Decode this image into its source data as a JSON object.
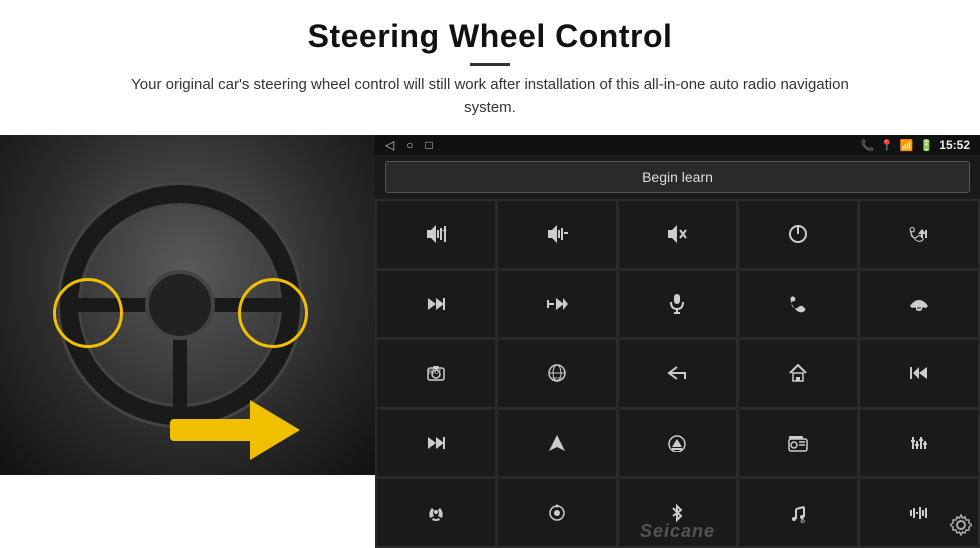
{
  "header": {
    "title": "Steering Wheel Control",
    "divider": true,
    "subtitle": "Your original car's steering wheel control will still work after installation of this all-in-one auto radio navigation system."
  },
  "android_panel": {
    "status_bar": {
      "nav_icons": [
        "◁",
        "○",
        "□"
      ],
      "right_icons": [
        "📞",
        "📍",
        "📶"
      ],
      "time": "15:52"
    },
    "begin_learn_label": "Begin learn",
    "grid_icons": [
      "🔊+",
      "🔊-",
      "🔊×",
      "⏻",
      "📞⏮",
      "⏭|",
      "✗⏭",
      "🎤",
      "📞",
      "↩",
      "📢",
      "360°",
      "↩",
      "🏠",
      "⏮⏮",
      "⏭⏭",
      "▶",
      "⏏",
      "📻",
      "⚙",
      "🎙",
      "⊙",
      "✱",
      "🎵",
      "📊"
    ],
    "watermark": "Seicane",
    "settings_icon": "⚙"
  }
}
